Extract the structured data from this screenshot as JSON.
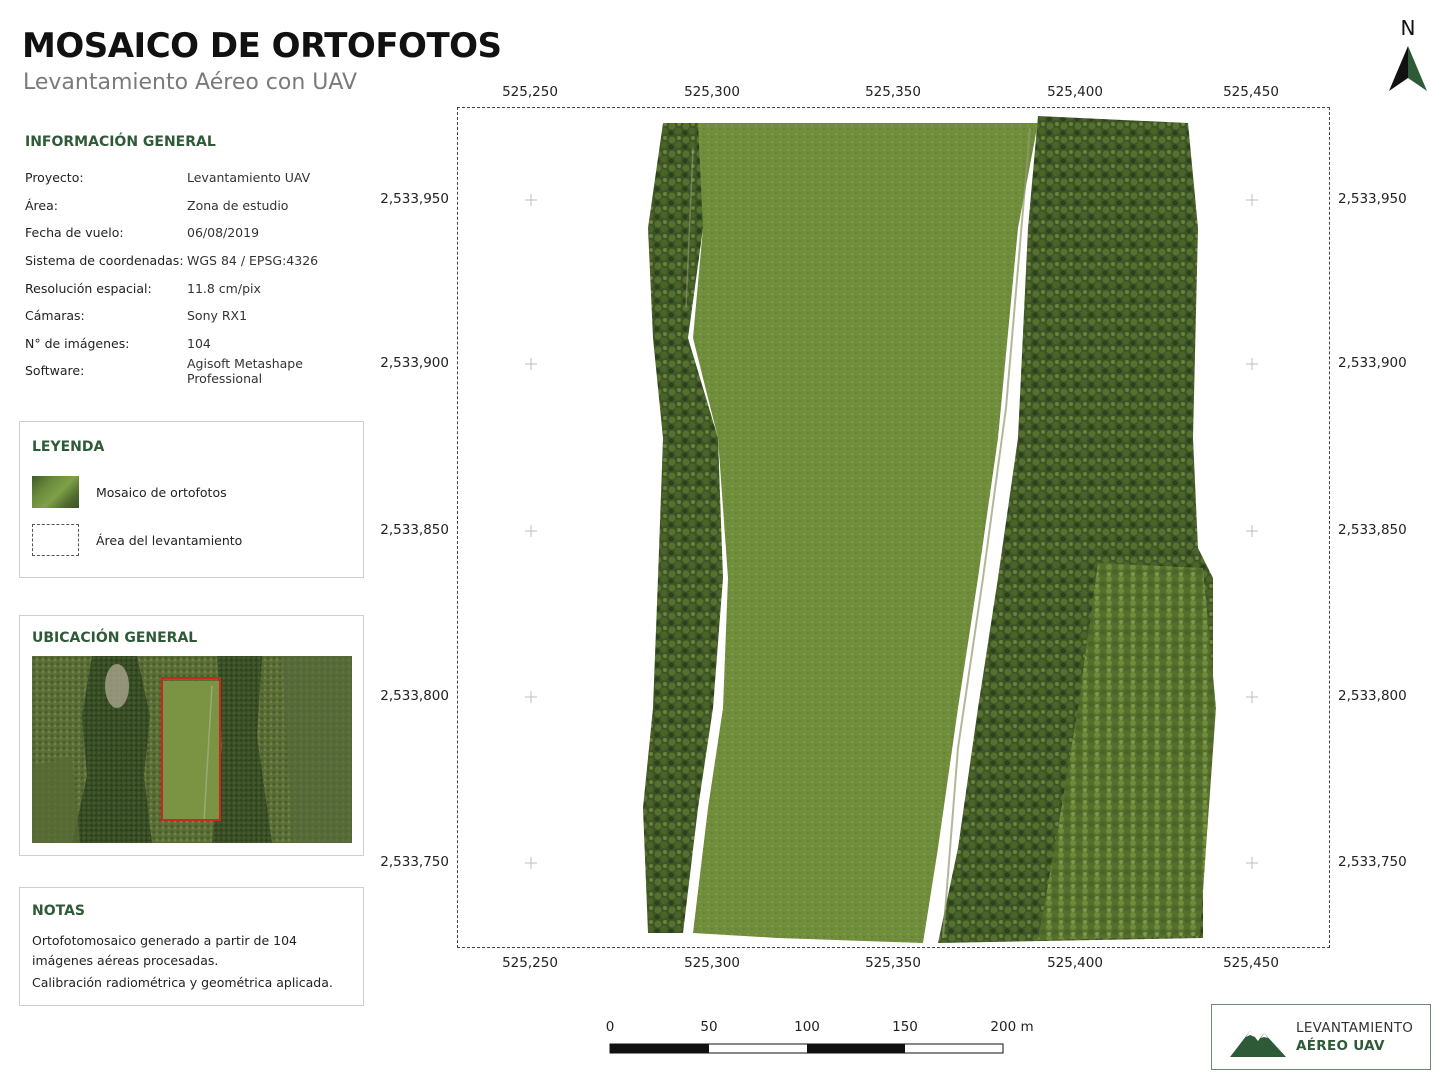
{
  "header": {
    "title": "MOSAICO DE ORTOFOTOS",
    "subtitle": "Levantamiento Aéreo con UAV"
  },
  "info": {
    "title": "INFORMACIÓN GENERAL",
    "rows": [
      {
        "label": "Proyecto:",
        "value": "Levantamiento UAV"
      },
      {
        "label": "Área:",
        "value": "Zona de estudio"
      },
      {
        "label": "Fecha de vuelo:",
        "value": "06/08/2019"
      },
      {
        "label": "Sistema de coordenadas:",
        "value": "WGS 84 / EPSG:4326"
      },
      {
        "label": "Resolución espacial:",
        "value": "11.8 cm/pix"
      },
      {
        "label": "Cámaras:",
        "value": "Sony RX1"
      },
      {
        "label": "N° de imágenes:",
        "value": "104"
      },
      {
        "label": "Software:",
        "value": "Agisoft Metashape Professional"
      }
    ]
  },
  "legend": {
    "title": "LEYENDA",
    "items": [
      {
        "label": "Mosaico de ortofotos",
        "symbol": "raster-swatch"
      },
      {
        "label": "Área del levantamiento",
        "symbol": "dashed-rectangle"
      }
    ]
  },
  "location": {
    "title": "UBICACIÓN GENERAL",
    "highlight_color": "#c8281e"
  },
  "notes": {
    "title": "NOTAS",
    "line1": "Ortofotomosaico generado a partir de 104 imágenes aéreas procesadas.",
    "line2": "Calibración radiométrica y geométrica aplicada."
  },
  "map": {
    "x_ticks": [
      "525,250",
      "525,300",
      "525,350",
      "525,400",
      "525,450"
    ],
    "y_ticks": [
      "2,533,950",
      "2,533,900",
      "2,533,850",
      "2,533,800",
      "2,533,750"
    ],
    "grid_marks": "crosses"
  },
  "north_arrow": {
    "label": "N"
  },
  "scalebar": {
    "labels": [
      "0",
      "50",
      "100",
      "150",
      "200 m"
    ]
  },
  "logo": {
    "line1": "LEVANTAMIENTO",
    "line2": "AÉREO UAV",
    "color": "#2f5a37"
  },
  "colors": {
    "accent": "#2f5a37",
    "grass": "#6f8d3a",
    "forest": "#3c5426"
  }
}
